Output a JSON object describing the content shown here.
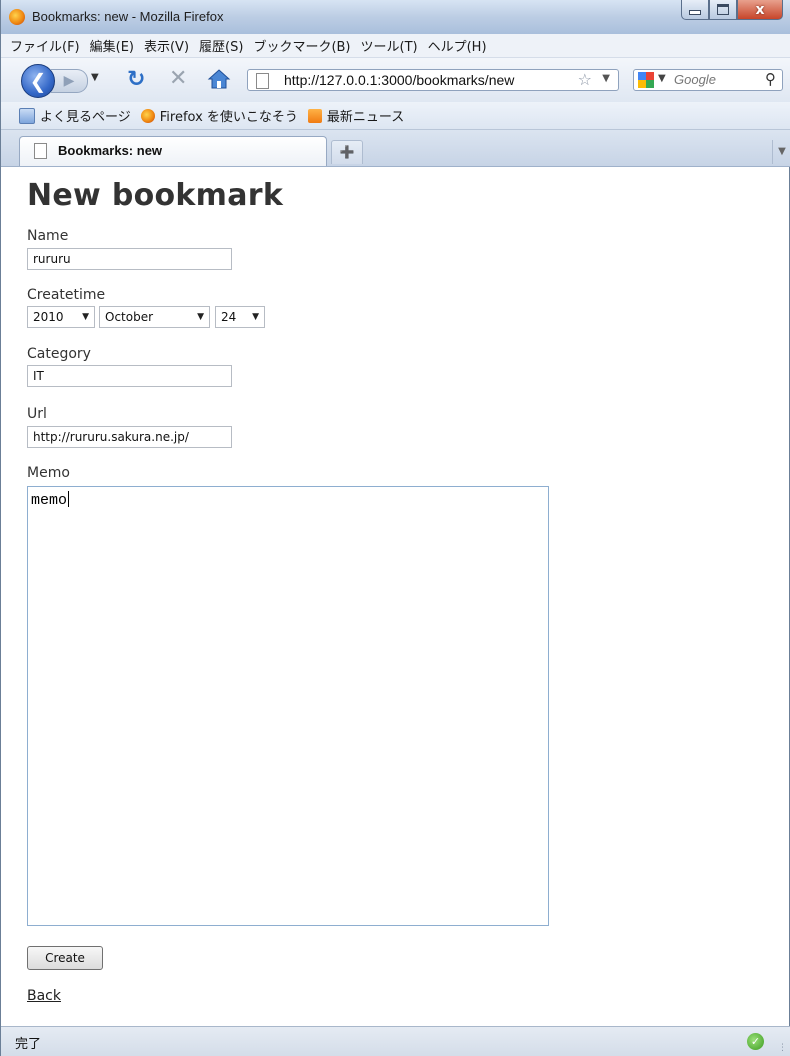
{
  "window": {
    "title": "Bookmarks: new - Mozilla Firefox",
    "controls": {
      "minimize": "",
      "maximize": "",
      "close": "x"
    }
  },
  "menu": [
    "ファイル(F)",
    "編集(E)",
    "表示(V)",
    "履歴(S)",
    "ブックマーク(B)",
    "ツール(T)",
    "ヘルプ(H)"
  ],
  "navbar": {
    "url": "http://127.0.0.1:3000/bookmarks/new",
    "search_placeholder": "Google",
    "icons": [
      "back-icon",
      "forward-icon",
      "reload-icon",
      "stop-icon",
      "home-icon",
      "star-icon",
      "search-icon"
    ]
  },
  "bookmarks_bar": [
    {
      "label": "よく見るページ",
      "icon": "smart-folder-icon"
    },
    {
      "label": "Firefox を使いこなそう",
      "icon": "firefox-icon"
    },
    {
      "label": "最新ニュース",
      "icon": "rss-icon"
    }
  ],
  "tabs": [
    {
      "label": "Bookmarks: new",
      "active": true
    }
  ],
  "page": {
    "title": "New bookmark",
    "name_label": "Name",
    "name_value": "rururu",
    "createtime_label": "Createtime",
    "year": "2010",
    "month": "October",
    "day": "24",
    "category_label": "Category",
    "category_value": "IT",
    "url_label": "Url",
    "url_value": "http://rururu.sakura.ne.jp/",
    "memo_label": "Memo",
    "memo_value": "memo",
    "create_button": "Create",
    "back_link": "Back"
  },
  "status": {
    "text": "完了"
  },
  "colors": {
    "accent": "#3468c8",
    "title_text": "#333333"
  }
}
